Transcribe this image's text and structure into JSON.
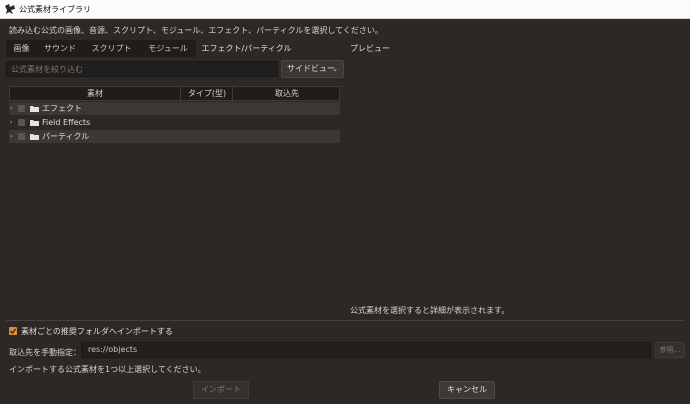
{
  "window": {
    "title": "公式素材ライブラリ"
  },
  "instructions": "読み込む公式の画像、音源、スクリプト、モジュール、エフェクト、パーティクルを選択してください。",
  "tabs": [
    {
      "label": "画像",
      "active": false
    },
    {
      "label": "サウンド",
      "active": false
    },
    {
      "label": "スクリプト",
      "active": false
    },
    {
      "label": "モジュール",
      "active": false
    },
    {
      "label": "エフェクト/パーティクル",
      "active": true
    }
  ],
  "preview": {
    "label": "プレビュー",
    "hint": "公式素材を選択すると詳細が表示されます。"
  },
  "filter": {
    "placeholder": "公式素材を絞り込む",
    "view_mode": "サイドビュー"
  },
  "table": {
    "headers": [
      "素材",
      "タイプ(型)",
      "取込先"
    ],
    "rows": [
      {
        "label": "エフェクト",
        "checked": false,
        "expanded": false
      },
      {
        "label": "Field Effects",
        "checked": false,
        "expanded": false
      },
      {
        "label": "パーティクル",
        "checked": false,
        "expanded": false
      }
    ]
  },
  "options": {
    "recommend_label": "素材ごとの推奨フォルダへインポートする",
    "recommend_checked": true,
    "dest_label": "取込先を手動指定：",
    "dest_value": "res://objects",
    "browse_label": "参照..."
  },
  "status_msg": "インポートする公式素材を1つ以上選択してください。",
  "buttons": {
    "import": "インポート",
    "cancel": "キャンセル"
  },
  "colors": {
    "accent": "#e08a3c",
    "background": "#2b2826",
    "titlebar": "#fbfbfb"
  }
}
